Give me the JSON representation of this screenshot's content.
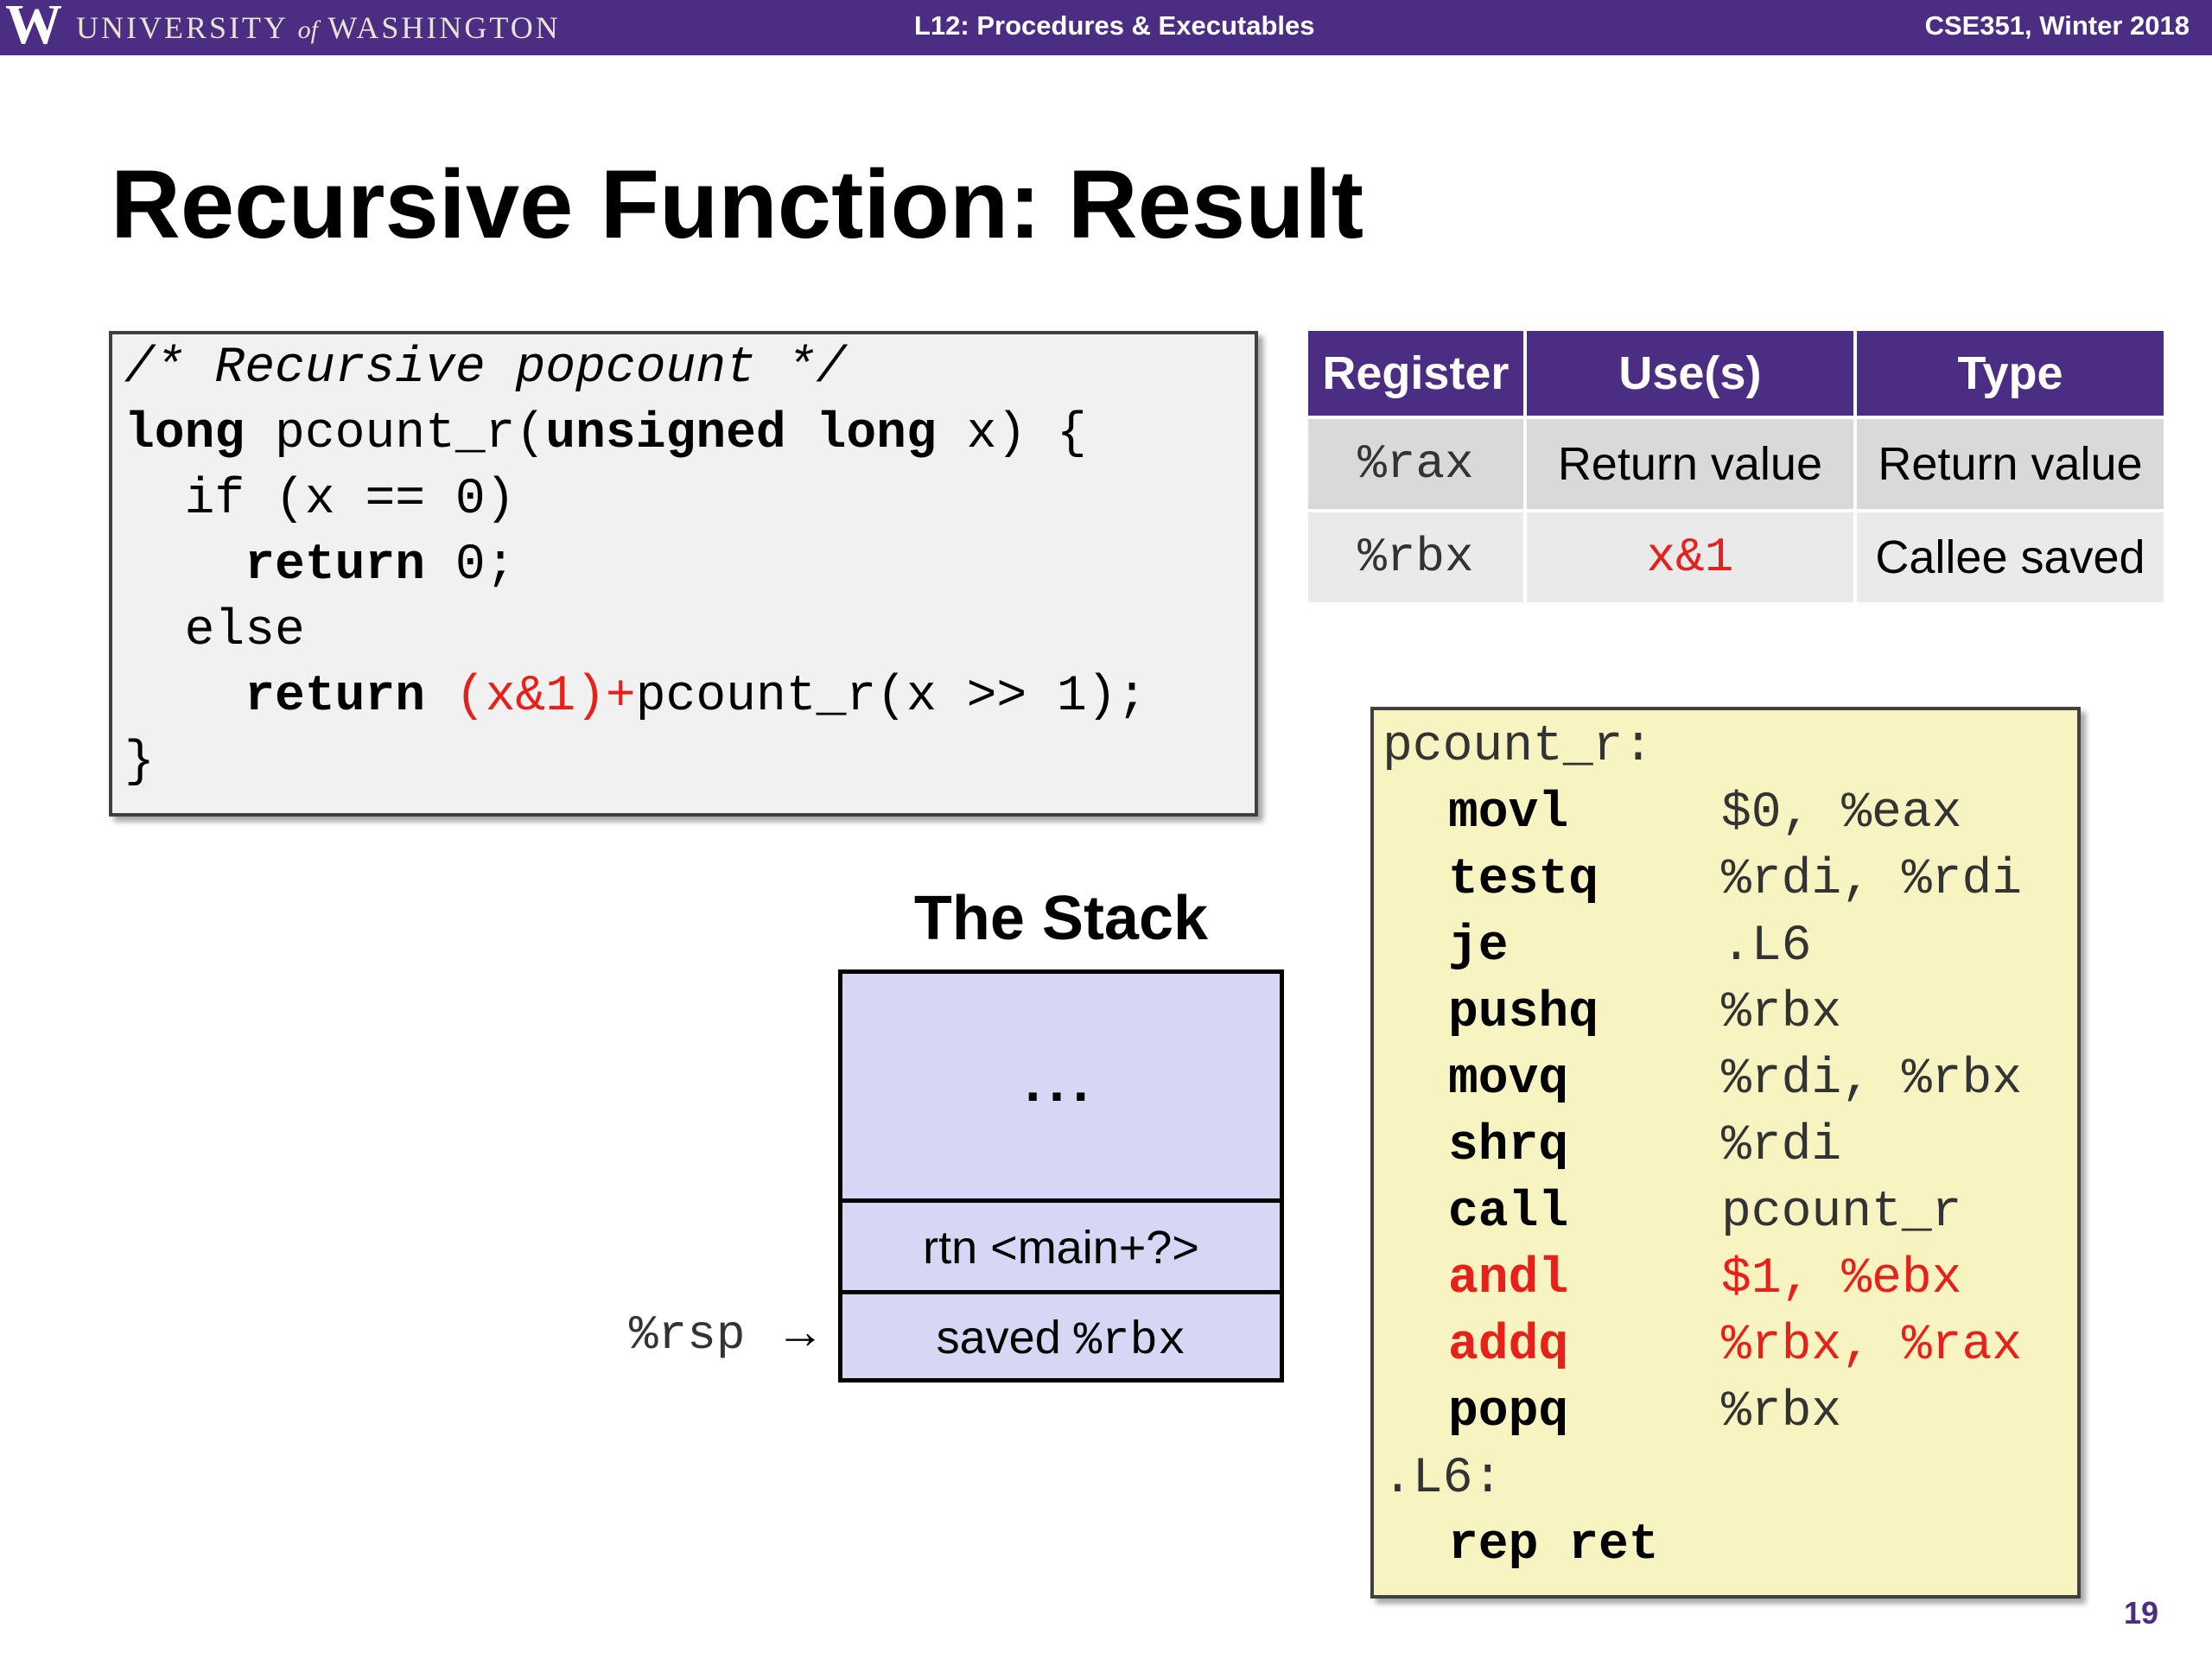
{
  "header": {
    "logo_letter": "W",
    "university_left": "UNIVERSITY",
    "university_of": "of",
    "university_right": "WASHINGTON",
    "lecture": "L12: Procedures & Executables",
    "course": "CSE351, Winter 2018"
  },
  "title": "Recursive Function:  Result",
  "c_code": {
    "comment": "/* Recursive popcount */",
    "l2_kw1": "long",
    "l2_mid": " pcount_r(",
    "l2_kw2": "unsigned long",
    "l2_end": " x) {",
    "l3": "  if (x == 0)",
    "l4_kw": "return",
    "l4_end": " 0;",
    "l5": "  else",
    "l6_kw": "return",
    "l6_red": "(x&1)+",
    "l6_end": "pcount_r(x >> 1);",
    "l7": "}"
  },
  "register_table": {
    "headers": [
      "Register",
      "Use(s)",
      "Type"
    ],
    "rows": [
      [
        "%rax",
        "Return value",
        "Return value"
      ],
      [
        "%rbx",
        "x&1",
        "Callee saved"
      ]
    ]
  },
  "stack": {
    "title": "The Stack",
    "dots": "...",
    "rtn": "rtn <main+?>",
    "saved_prefix": "saved ",
    "saved_reg": "%rbx",
    "rsp_label": "%rsp",
    "arrow": "→"
  },
  "assembly": {
    "label1": "pcount_r:",
    "instructions": [
      {
        "op": "movl",
        "args": "$0, %eax"
      },
      {
        "op": "testq",
        "args": "%rdi, %rdi"
      },
      {
        "op": "je",
        "args": ".L6"
      },
      {
        "op": "pushq",
        "args": "%rbx"
      },
      {
        "op": "movq",
        "args": "%rdi, %rbx"
      },
      {
        "op": "shrq",
        "args": "%rdi"
      },
      {
        "op": "call",
        "args": "pcount_r"
      },
      {
        "op": "andl",
        "args": "$1, %ebx"
      },
      {
        "op": "addq",
        "args": "%rbx, %rax"
      },
      {
        "op": "popq",
        "args": "%rbx"
      }
    ],
    "label2": ".L6:",
    "last_op": "rep ret"
  },
  "page_number": "19",
  "colors": {
    "uw_purple": "#4b2e83",
    "highlight_red": "#e8201a",
    "stack_fill": "#d6d6f5",
    "asm_fill": "#f8f4c1"
  }
}
